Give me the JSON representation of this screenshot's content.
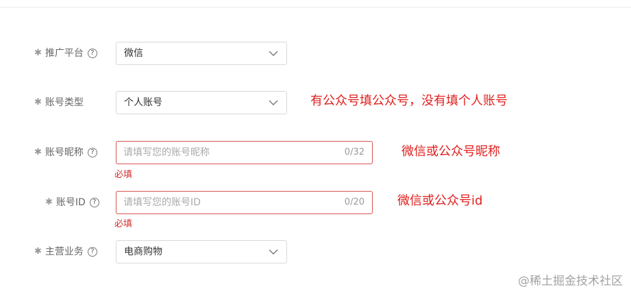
{
  "form": {
    "platform": {
      "label": "推广平台",
      "value": "微信"
    },
    "account_type": {
      "label": "账号类型",
      "value": "个人账号"
    },
    "nickname": {
      "label": "账号昵称",
      "placeholder": "请填写您的账号昵称",
      "counter": "0/32",
      "error": "必填"
    },
    "account_id": {
      "label": "账号ID",
      "placeholder": "请填写您的账号ID",
      "counter": "0/20",
      "error": "必填"
    },
    "business": {
      "label": "主营业务",
      "value": "电商购物"
    }
  },
  "annotations": {
    "account_type_note": "有公众号填公众号，没有填个人账号",
    "nickname_note": "微信或公众号昵称",
    "account_id_note": "微信或公众号id"
  },
  "watermark": "@稀土掘金技术社区",
  "colors": {
    "error": "#d32f2f",
    "annotation": "#e0201f",
    "input_error_border": "#d9534f"
  },
  "icons": {
    "help": "question-circle-icon",
    "dropdown": "chevron-down-icon"
  }
}
